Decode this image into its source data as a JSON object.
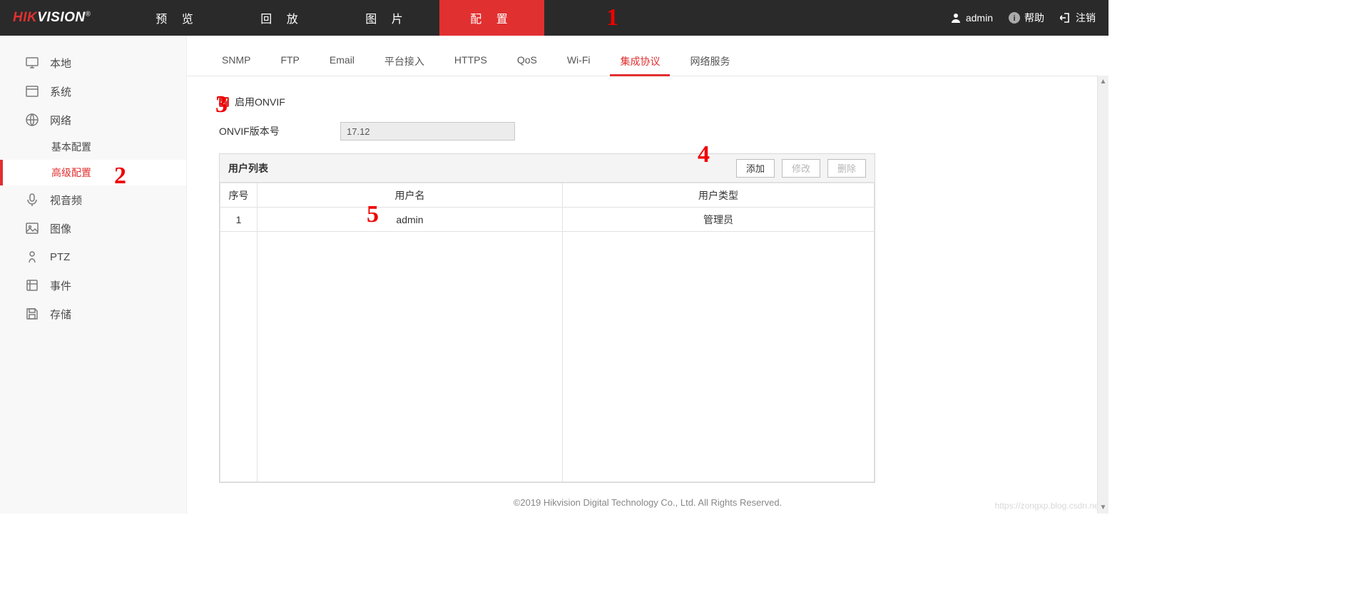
{
  "logo": {
    "part1": "HIK",
    "part2": "VISION",
    "reg": "®"
  },
  "topnav": {
    "items": [
      {
        "label": "预 览",
        "active": false
      },
      {
        "label": "回 放",
        "active": false
      },
      {
        "label": "图 片",
        "active": false
      },
      {
        "label": "配 置",
        "active": true
      }
    ]
  },
  "topright": {
    "user": "admin",
    "help": "帮助",
    "logout": "注销"
  },
  "sidebar": {
    "items": [
      {
        "label": "本地",
        "icon": "monitor"
      },
      {
        "label": "系统",
        "icon": "window"
      },
      {
        "label": "网络",
        "icon": "globe",
        "children": [
          {
            "label": "基本配置",
            "active": false
          },
          {
            "label": "高级配置",
            "active": true
          }
        ]
      },
      {
        "label": "视音频",
        "icon": "mic"
      },
      {
        "label": "图像",
        "icon": "image"
      },
      {
        "label": "PTZ",
        "icon": "ptz"
      },
      {
        "label": "事件",
        "icon": "event"
      },
      {
        "label": "存储",
        "icon": "save"
      }
    ]
  },
  "subtabs": {
    "items": [
      {
        "label": "SNMP"
      },
      {
        "label": "FTP"
      },
      {
        "label": "Email"
      },
      {
        "label": "平台接入"
      },
      {
        "label": "HTTPS"
      },
      {
        "label": "QoS"
      },
      {
        "label": "Wi-Fi"
      },
      {
        "label": "集成协议",
        "active": true
      },
      {
        "label": "网络服务"
      }
    ]
  },
  "form": {
    "enable_onvif_label": "启用ONVIF",
    "enable_onvif_checked": true,
    "version_label": "ONVIF版本号",
    "version_value": "17.12"
  },
  "table": {
    "title": "用户列表",
    "btn_add": "添加",
    "btn_edit": "修改",
    "btn_delete": "删除",
    "headers": {
      "index": "序号",
      "username": "用户名",
      "usertype": "用户类型"
    },
    "rows": [
      {
        "index": "1",
        "username": "admin",
        "usertype": "管理员"
      }
    ]
  },
  "footer": "©2019 Hikvision Digital Technology Co., Ltd. All Rights Reserved.",
  "watermark": "https://zongxp.blog.csdn.net",
  "annotations": {
    "a1": "1",
    "a2": "2",
    "a3": "3",
    "a4": "4",
    "a5": "5"
  }
}
